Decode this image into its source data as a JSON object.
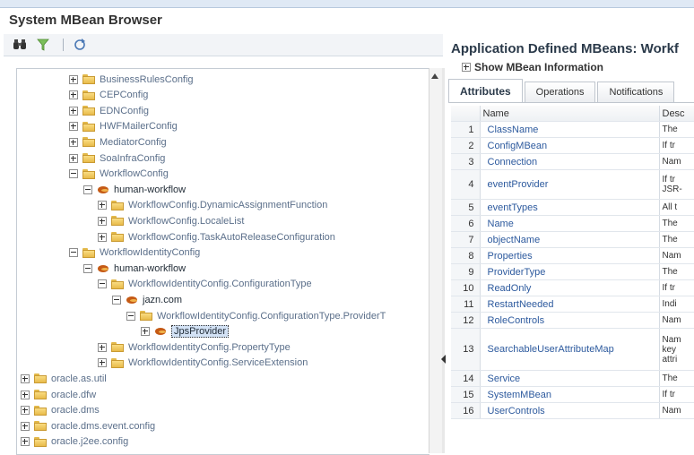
{
  "title": "System MBean Browser",
  "toolbar": {
    "icons": [
      "binoculars-icon",
      "filter-icon",
      "refresh-icon"
    ]
  },
  "tree": [
    {
      "label": "BusinessRulesConfig",
      "type": "folder",
      "exp": "plus",
      "indent": 0
    },
    {
      "label": "CEPConfig",
      "type": "folder",
      "exp": "plus",
      "indent": 0
    },
    {
      "label": "EDNConfig",
      "type": "folder",
      "exp": "plus",
      "indent": 0
    },
    {
      "label": "HWFMailerConfig",
      "type": "folder",
      "exp": "plus",
      "indent": 0
    },
    {
      "label": "MediatorConfig",
      "type": "folder",
      "exp": "plus",
      "indent": 0
    },
    {
      "label": "SoaInfraConfig",
      "type": "folder",
      "exp": "plus",
      "indent": 0
    },
    {
      "label": "WorkflowConfig",
      "type": "folder",
      "exp": "minus",
      "indent": 0
    },
    {
      "label": "human-workflow",
      "type": "bean",
      "exp": "minus",
      "indent": 1
    },
    {
      "label": "WorkflowConfig.DynamicAssignmentFunction",
      "type": "folder",
      "exp": "plus",
      "indent": 2
    },
    {
      "label": "WorkflowConfig.LocaleList",
      "type": "folder",
      "exp": "plus",
      "indent": 2
    },
    {
      "label": "WorkflowConfig.TaskAutoReleaseConfiguration",
      "type": "folder",
      "exp": "plus",
      "indent": 2
    },
    {
      "label": "WorkflowIdentityConfig",
      "type": "folder",
      "exp": "minus",
      "indent": 0
    },
    {
      "label": "human-workflow",
      "type": "bean",
      "exp": "minus",
      "indent": 1
    },
    {
      "label": "WorkflowIdentityConfig.ConfigurationType",
      "type": "folder",
      "exp": "minus",
      "indent": 2
    },
    {
      "label": "jazn.com",
      "type": "bean",
      "exp": "minus",
      "indent": 3
    },
    {
      "label": "WorkflowIdentityConfig.ConfigurationType.ProviderT",
      "type": "folder",
      "exp": "minus",
      "indent": 4
    },
    {
      "label": "JpsProvider",
      "type": "bean",
      "exp": "plus",
      "indent": 5,
      "selected": true
    },
    {
      "label": "WorkflowIdentityConfig.PropertyType",
      "type": "folder",
      "exp": "plus",
      "indent": 2
    },
    {
      "label": "WorkflowIdentityConfig.ServiceExtension",
      "type": "folder",
      "exp": "plus",
      "indent": 2
    },
    {
      "label": "oracle.as.util",
      "type": "folder",
      "exp": "plus",
      "indent": -1
    },
    {
      "label": "oracle.dfw",
      "type": "folder",
      "exp": "plus",
      "indent": -1
    },
    {
      "label": "oracle.dms",
      "type": "folder",
      "exp": "plus",
      "indent": -1
    },
    {
      "label": "oracle.dms.event.config",
      "type": "folder",
      "exp": "plus",
      "indent": -1
    },
    {
      "label": "oracle.j2ee.config",
      "type": "folder",
      "exp": "plus",
      "indent": -1
    }
  ],
  "right_panel": {
    "title": "Application Defined MBeans: Workf",
    "show_info": "Show MBean Information",
    "tabs": [
      "Attributes",
      "Operations",
      "Notifications"
    ],
    "columns": {
      "name": "Name",
      "desc": "Desc"
    },
    "rows": [
      {
        "num": "1",
        "name": "ClassName",
        "desc": [
          "The"
        ]
      },
      {
        "num": "2",
        "name": "ConfigMBean",
        "desc": [
          "If tr"
        ]
      },
      {
        "num": "3",
        "name": "Connection",
        "desc": [
          "Nam"
        ]
      },
      {
        "num": "4",
        "name": "eventProvider",
        "desc": [
          "If tr",
          "JSR-"
        ],
        "size": "tall"
      },
      {
        "num": "5",
        "name": "eventTypes",
        "desc": [
          "All t"
        ]
      },
      {
        "num": "6",
        "name": "Name",
        "desc": [
          "The"
        ]
      },
      {
        "num": "7",
        "name": "objectName",
        "desc": [
          "The"
        ]
      },
      {
        "num": "8",
        "name": "Properties",
        "desc": [
          "Nam"
        ]
      },
      {
        "num": "9",
        "name": "ProviderType",
        "desc": [
          "The"
        ]
      },
      {
        "num": "10",
        "name": "ReadOnly",
        "desc": [
          "If tr"
        ]
      },
      {
        "num": "11",
        "name": "RestartNeeded",
        "desc": [
          "Indi"
        ]
      },
      {
        "num": "12",
        "name": "RoleControls",
        "desc": [
          "Nam"
        ]
      },
      {
        "num": "13",
        "name": "SearchableUserAttributeMap",
        "desc": [
          "Nam",
          "key",
          "attri"
        ],
        "size": "xtall"
      },
      {
        "num": "14",
        "name": "Service",
        "desc": [
          "The"
        ]
      },
      {
        "num": "15",
        "name": "SystemMBean",
        "desc": [
          "If tr"
        ]
      },
      {
        "num": "16",
        "name": "UserControls",
        "desc": [
          "Nam"
        ]
      }
    ]
  }
}
